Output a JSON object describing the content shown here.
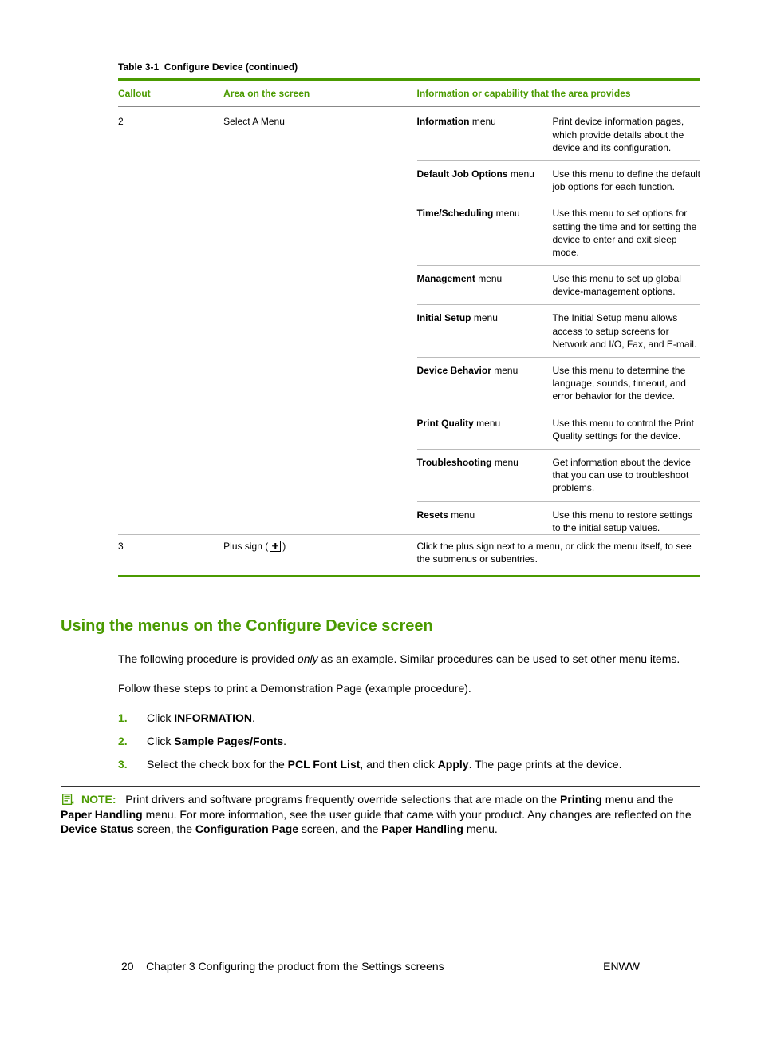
{
  "table": {
    "caption_prefix": "Table 3-1",
    "caption_text": "Configure Device (continued)",
    "headers": [
      "Callout",
      "Area on the screen",
      "Information or capability that the area provides"
    ],
    "row2": {
      "callout": "2",
      "area": "Select A Menu",
      "menus": [
        {
          "name": "Information",
          "suffix": " menu",
          "desc": "Print device information pages, which provide details about the device and its configuration."
        },
        {
          "name": "Default Job Options",
          "suffix": " menu",
          "desc": "Use this menu to define the default job options for each function."
        },
        {
          "name": "Time/Scheduling",
          "suffix": " menu",
          "desc": "Use this menu to set options for setting the time and for setting the device to enter and exit sleep mode."
        },
        {
          "name": "Management",
          "suffix": " menu",
          "desc": "Use this menu to set up global device-management options."
        },
        {
          "name": "Initial Setup",
          "suffix": " menu",
          "desc": "The Initial Setup menu allows access to setup screens for Network and I/O, Fax, and E-mail."
        },
        {
          "name": "Device Behavior",
          "suffix": " menu",
          "desc": "Use this menu to determine the language, sounds, timeout, and error behavior for the device."
        },
        {
          "name": "Print Quality",
          "suffix": " menu",
          "desc": "Use this menu to control the Print Quality settings for the device."
        },
        {
          "name": "Troubleshooting",
          "suffix": " menu",
          "desc": "Get information about the device that you can use to troubleshoot problems."
        },
        {
          "name": "Resets",
          "suffix": " menu",
          "desc": "Use this menu to restore settings to the initial setup values."
        }
      ]
    },
    "row3": {
      "callout": "3",
      "area_prefix": "Plus sign (",
      "area_suffix": ")",
      "info": "Click the plus sign next to a menu, or click the menu itself, to see the submenus or subentries."
    }
  },
  "section_heading": "Using the menus on the Configure Device screen",
  "para1_a": "The following procedure is provided ",
  "para1_italic": "only",
  "para1_b": " as an example. Similar procedures can be used to set other menu items.",
  "para2": "Follow these steps to print a Demonstration Page (example procedure).",
  "steps": [
    {
      "pre": "Click ",
      "b1": "INFORMATION",
      "post": "."
    },
    {
      "pre": "Click ",
      "b1": "Sample Pages/Fonts",
      "post": "."
    },
    {
      "pre": "Select the check box for the ",
      "b1": "PCL Font List",
      "mid": ", and then click ",
      "b2": "Apply",
      "post": ". The page prints at the device."
    }
  ],
  "note": {
    "label": "NOTE:",
    "t1": "Print drivers and software programs frequently override selections that are made on the ",
    "b1": "Printing",
    "t2": " menu and the ",
    "b2": "Paper Handling",
    "t3": " menu. For more information, see the user guide that came with your product. Any changes are reflected on the ",
    "b3": "Device Status",
    "t4": " screen, the ",
    "b4": "Configuration Page",
    "t5": " screen, and the ",
    "b5": "Paper Handling",
    "t6": " menu."
  },
  "footer": {
    "page": "20",
    "chapter": "Chapter 3   Configuring the product from the Settings screens",
    "right": "ENWW"
  }
}
